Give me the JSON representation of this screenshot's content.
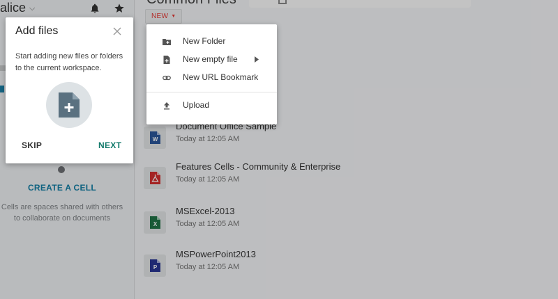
{
  "user": {
    "name": "alice"
  },
  "sidebar": {
    "create_cell": "CREATE A CELL",
    "cells_desc": "Cells are spaces shared with others to collaborate on documents"
  },
  "main": {
    "title": "Common Files",
    "new_button": "NEW",
    "files": [
      {
        "name": "Document Office Sample",
        "date": "Today at 12:05 AM",
        "type": "word",
        "color": "#2b579a"
      },
      {
        "name": "Features Cells - Community & Enterprise",
        "date": "Today at 12:05 AM",
        "type": "pdf",
        "color": "#d32f2f"
      },
      {
        "name": "MSExcel-2013",
        "date": "Today at 12:05 AM",
        "type": "excel",
        "color": "#217346"
      },
      {
        "name": "MSPowerPoint2013",
        "date": "Today at 12:05 AM",
        "type": "powerpoint",
        "color": "#283593"
      }
    ]
  },
  "onboarding": {
    "title": "Add files",
    "description": "Start adding new files or folders to the current workspace.",
    "skip": "SKIP",
    "next": "NEXT"
  },
  "new_menu": {
    "items": [
      {
        "label": "New Folder",
        "icon": "folder-plus-icon"
      },
      {
        "label": "New empty file",
        "icon": "file-plus-icon",
        "submenu": true
      },
      {
        "label": "New URL Bookmark",
        "icon": "link-icon"
      },
      {
        "label": "Upload",
        "icon": "upload-icon"
      }
    ]
  },
  "colors": {
    "accent_red": "#e53935",
    "teal": "#127a6b",
    "blue": "#127ea5"
  }
}
